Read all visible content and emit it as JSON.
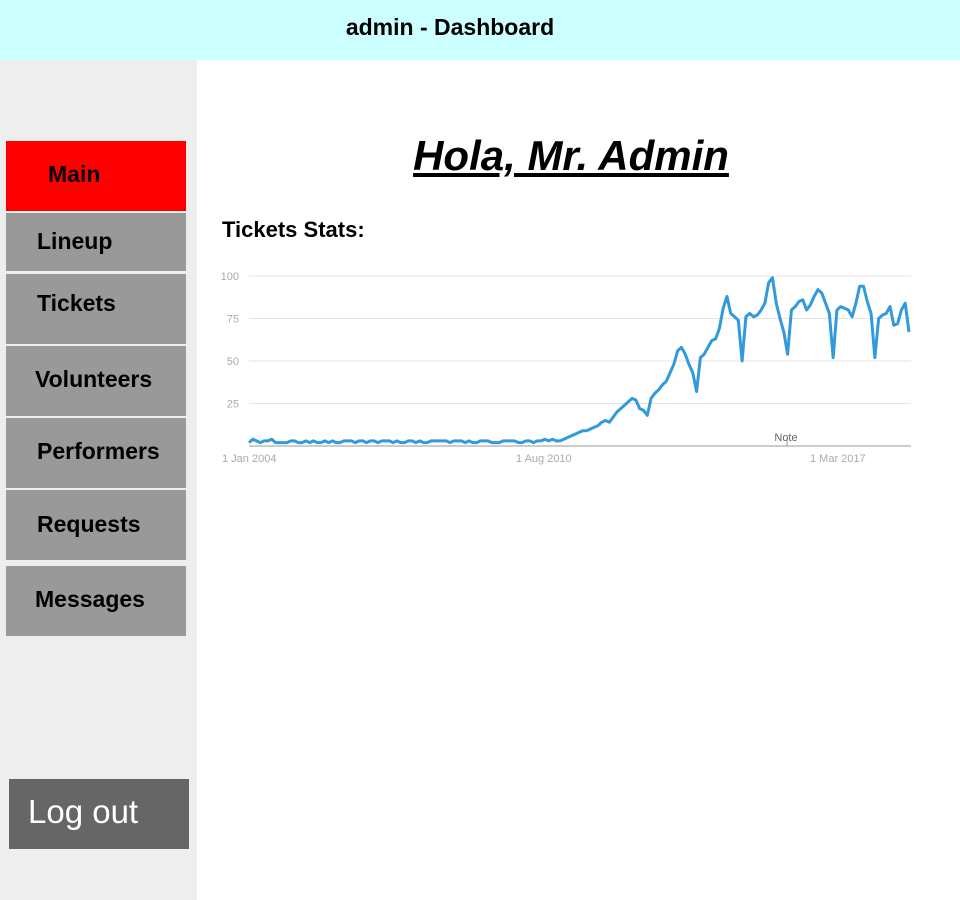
{
  "header": {
    "title": "admin - Dashboard"
  },
  "sidebar": {
    "items": [
      {
        "label": "Main",
        "active": true
      },
      {
        "label": "Lineup"
      },
      {
        "label": "Tickets"
      },
      {
        "label": "Volunteers"
      },
      {
        "label": "Performers"
      },
      {
        "label": "Requests"
      },
      {
        "label": "Messages"
      }
    ],
    "logout_label": "Log out",
    "active_color": "#ff0000",
    "item_color": "#999999"
  },
  "main": {
    "greeting": "Hola, Mr. Admin",
    "stats_heading": "Tickets Stats:"
  },
  "colors": {
    "header_bg": "#ccffff",
    "sidebar_bg": "#eeeeee",
    "logout_bg": "#666666",
    "series_color": "#3399dd"
  },
  "chart_data": {
    "type": "line",
    "title": "",
    "xlabel": "",
    "ylabel": "",
    "ylim": [
      0,
      100
    ],
    "y_ticks": [
      25,
      50,
      75,
      100
    ],
    "x_tick_labels": [
      "1 Jan 2004",
      "1 Aug 2010",
      "1 Mar 2017"
    ],
    "annotation": "Note",
    "grid": true,
    "series": [
      {
        "values": [
          2,
          4,
          3,
          2,
          3,
          3,
          4,
          2,
          2,
          2,
          2,
          3,
          3,
          2,
          2,
          3,
          2,
          3,
          2,
          2,
          3,
          2,
          3,
          2,
          2,
          3,
          3,
          3,
          2,
          3,
          3,
          2,
          3,
          3,
          2,
          3,
          3,
          3,
          2,
          3,
          2,
          2,
          3,
          3,
          2,
          3,
          2,
          2,
          3,
          3,
          3,
          3,
          3,
          2,
          3,
          3,
          3,
          2,
          3,
          2,
          2,
          3,
          3,
          3,
          2,
          2,
          2,
          3,
          3,
          3,
          3,
          2,
          2,
          3,
          3,
          2,
          3,
          3,
          4,
          3,
          4,
          3,
          3,
          4,
          5,
          6,
          7,
          8,
          9,
          9,
          10,
          11,
          12,
          14,
          15,
          14,
          17,
          20,
          22,
          24,
          26,
          28,
          27,
          22,
          21,
          18,
          28,
          31,
          33,
          36,
          38,
          43,
          48,
          56,
          58,
          54,
          48,
          43,
          32,
          52,
          54,
          58,
          62,
          63,
          69,
          81,
          88,
          78,
          76,
          74,
          50,
          76,
          78,
          76,
          77,
          80,
          84,
          96,
          99,
          84,
          75,
          67,
          54,
          80,
          82,
          85,
          86,
          80,
          83,
          88,
          92,
          90,
          84,
          78,
          52,
          80,
          82,
          81,
          80,
          76,
          84,
          94,
          94,
          85,
          78,
          52,
          75,
          77,
          78,
          82,
          71,
          72,
          80,
          84,
          67
        ]
      }
    ]
  }
}
